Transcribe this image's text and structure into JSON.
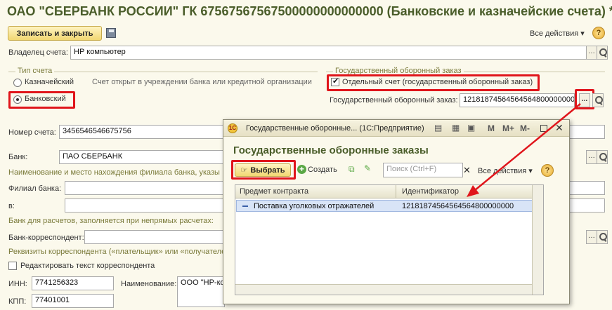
{
  "window": {
    "title": "ОАО \"СБЕРБАНК РОССИИ\" ГК 67567567567500000000000000 (Банковские и казначейские счета) *"
  },
  "toolbar": {
    "save_close_label": "Записать и закрыть",
    "all_actions_label": "Все действия ▾",
    "help_label": "?"
  },
  "owner": {
    "label": "Владелец счета:",
    "value": "НР компьютер"
  },
  "account_type": {
    "frame_title": "Тип счета",
    "treasury_label": "Казначейский",
    "bank_label": "Банковский",
    "description": "Счет открыт в учреждении банка или кредитной организации"
  },
  "defense_order": {
    "frame_title": "Государственный оборонный заказ",
    "separate_account_label": "Отдельный счет (государственный оборонный заказ)",
    "order_label": "Государственный оборонный заказ:",
    "order_value": "12181874564564564800000000",
    "pick_label": "..."
  },
  "account_number": {
    "label": "Номер счета:",
    "value": "3456546546675756"
  },
  "bank": {
    "label": "Банк:",
    "value": "ПАО СБЕРБАНК",
    "branch_name_heading": "Наименование и место нахождения  филиала банка, указы",
    "branch_label": "Филиал банка:",
    "in_label": "в:",
    "indirect_heading": "Банк для расчетов, заполняется при непрямых расчетах:",
    "correspondent_label": "Банк-корреспондент:",
    "requisites_heading": "Реквизиты корреспондента («плательщик» или «получателе",
    "edit_text_label": "Редактировать текст корреспондента",
    "inn_label": "ИНН:",
    "inn_value": "7741256323",
    "kpp_label": "КПП:",
    "kpp_value": "77401001",
    "name_label": "Наименование:",
    "name_value": "ООО \"НР-ко"
  },
  "dialog": {
    "window_title": "Государственные оборонные... (1С:Предприятие)",
    "heading": "Государственные оборонные заказы",
    "select_label": "Выбрать",
    "create_label": "Создать",
    "search_placeholder": "Поиск (Ctrl+F)",
    "all_actions_label": "Все действия ▾",
    "help_label": "?",
    "columns": [
      "Предмет контракта",
      "Идентификатор"
    ],
    "rows": [
      {
        "subject": "Поставка уголковых отражателей",
        "identifier": "12181874564564564800000000"
      }
    ],
    "title_buttons": [
      "M",
      "M+",
      "M-"
    ]
  },
  "colors": {
    "accent_red": "#e0151b",
    "title_green": "#4a5d2a",
    "background": "#fbf9ec"
  }
}
